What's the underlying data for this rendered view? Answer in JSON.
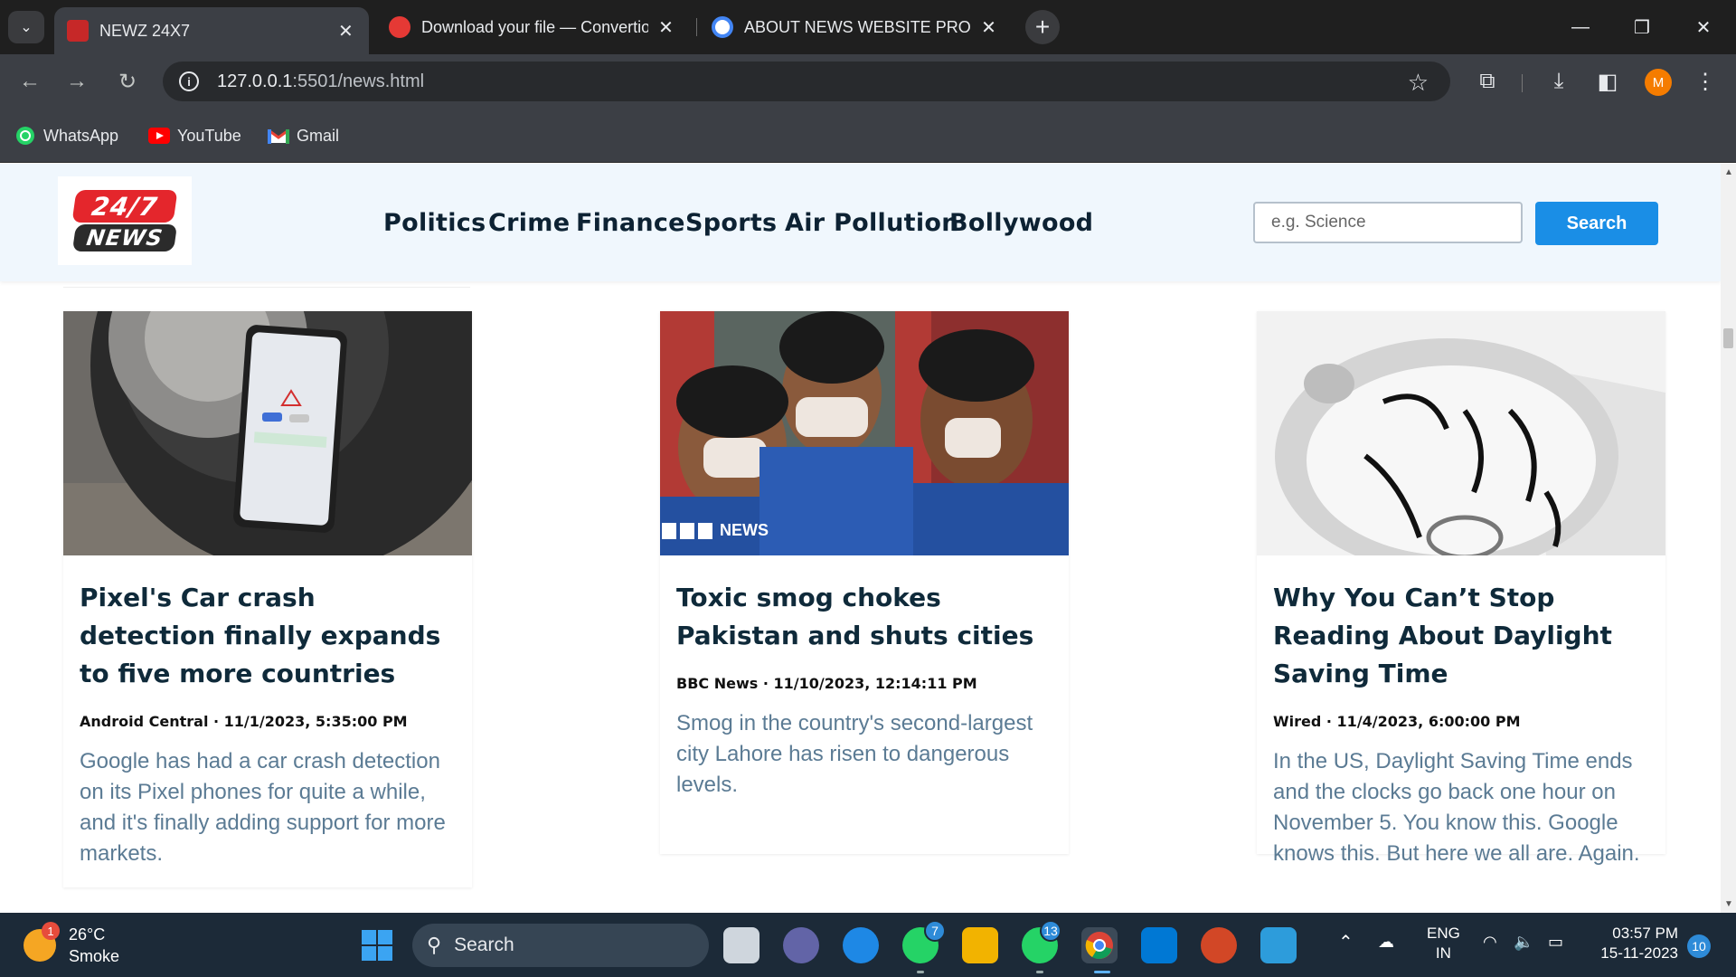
{
  "browser": {
    "tabs": [
      {
        "title": "NEWZ 24X7",
        "active": true
      },
      {
        "title": "Download your file — Convertio",
        "active": false
      },
      {
        "title": "ABOUT NEWS WEBSITE PROJECT",
        "active": false
      }
    ],
    "url_host": "127.0.0.1",
    "url_path": ":5501/news.html",
    "profile_initial": "M",
    "bookmarks": [
      "WhatsApp",
      "YouTube",
      "Gmail"
    ]
  },
  "site": {
    "logo_top": "24/7",
    "logo_bottom": "NEWS",
    "nav": [
      "Politics",
      "Crime",
      "Finance",
      "Sports",
      "Air Pollution",
      "Bollywood"
    ],
    "search_placeholder": "e.g. Science",
    "search_button": "Search"
  },
  "articles": [
    {
      "title": "Pixel's Car crash detection finally expands to five more countries",
      "meta": "Android Central · 11/1/2023, 5:35:00 PM",
      "description": "Google has had a car crash detection on its Pixel phones for quite a while, and it's finally adding support for more markets.",
      "image": "phone-on-tire"
    },
    {
      "title": "Toxic smog chokes Pakistan and shuts cities",
      "meta": "BBC News · 11/10/2023, 12:14:11 PM",
      "description": "Smog in the country's second-largest city Lahore has risen to dangerous levels.",
      "image": "children-with-masks",
      "image_watermark": "NEWS"
    },
    {
      "title": "Why You Can’t Stop Reading About Daylight Saving Time",
      "meta": "Wired · 11/4/2023, 6:00:00 PM",
      "description": "In the US, Daylight Saving Time ends and the clocks go back one hour on November 5. You know this. Google knows this. But here we all are. Again.",
      "image": "melting-clock"
    }
  ],
  "taskbar": {
    "weather_temp": "26°C",
    "weather_desc": "Smoke",
    "weather_badge": "1",
    "search_label": "Search",
    "whatsapp_badge": "7",
    "whatsapp2_badge": "13",
    "lang_top": "ENG",
    "lang_bottom": "IN",
    "time": "03:57 PM",
    "date": "15-11-2023",
    "notif_count": "10"
  }
}
